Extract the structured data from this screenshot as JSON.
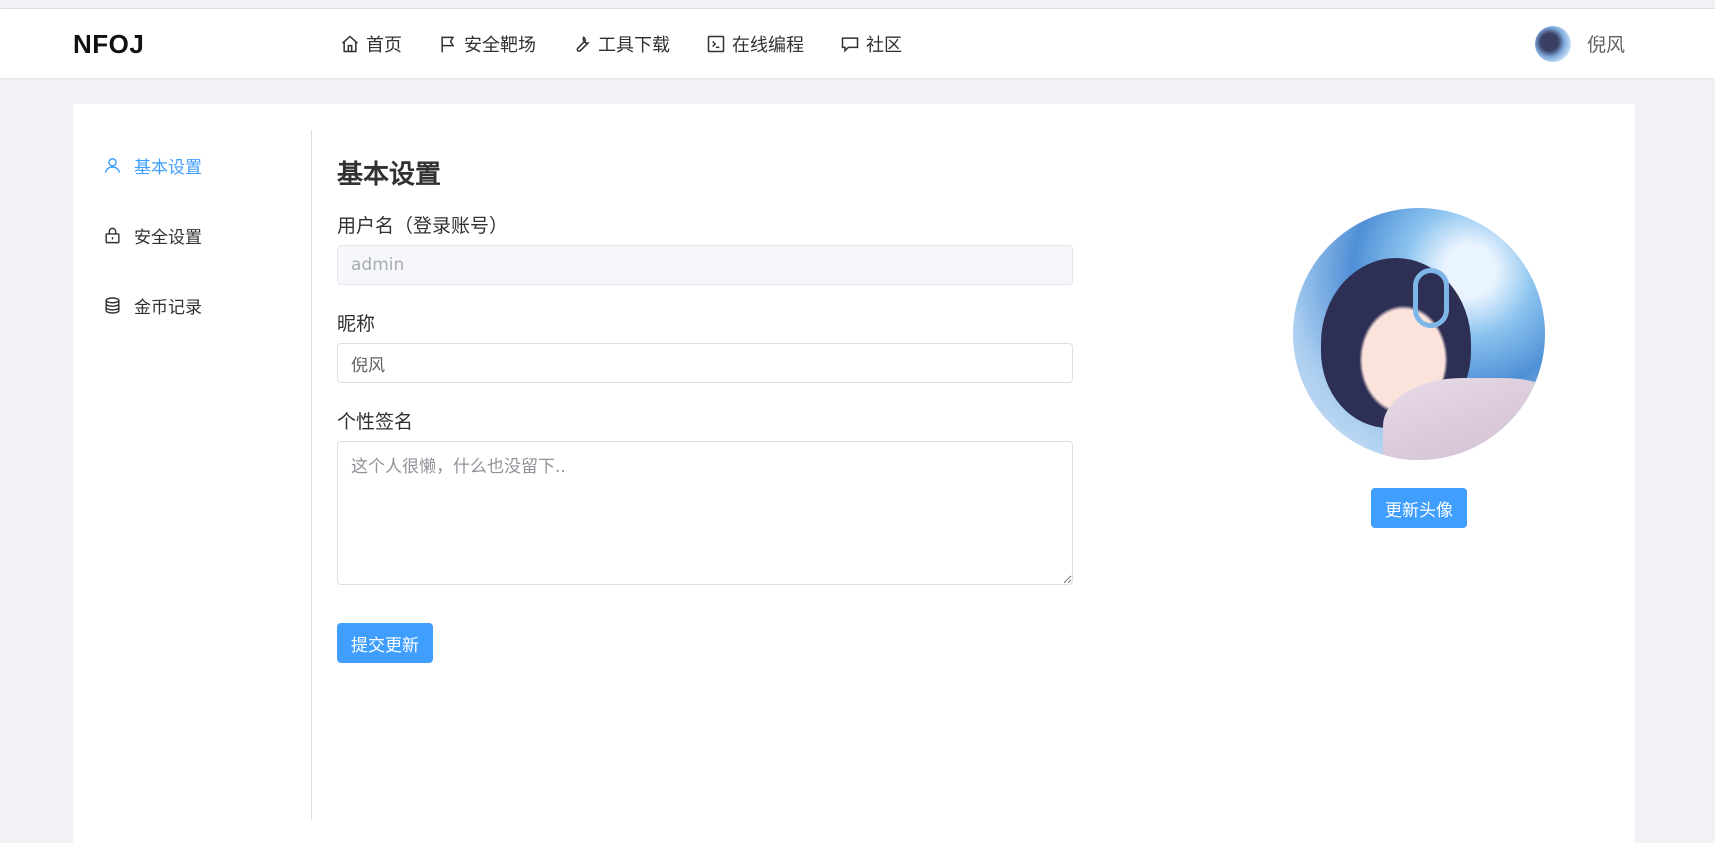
{
  "brand": "NFOJ",
  "nav": [
    {
      "label": "首页",
      "icon": "home-icon"
    },
    {
      "label": "安全靶场",
      "icon": "flag-icon"
    },
    {
      "label": "工具下载",
      "icon": "wrench-icon"
    },
    {
      "label": "在线编程",
      "icon": "terminal-icon"
    },
    {
      "label": "社区",
      "icon": "chat-icon"
    }
  ],
  "user": {
    "name": "倪风"
  },
  "sidebar": {
    "items": [
      {
        "label": "基本设置",
        "icon": "user-icon",
        "active": true
      },
      {
        "label": "安全设置",
        "icon": "lock-icon",
        "active": false
      },
      {
        "label": "金币记录",
        "icon": "coins-icon",
        "active": false
      }
    ]
  },
  "form": {
    "title": "基本设置",
    "username_label": "用户名（登录账号）",
    "username_value": "admin",
    "nickname_label": "昵称",
    "nickname_value": "倪风",
    "signature_label": "个性签名",
    "signature_placeholder": "这个人很懒，什么也没留下..",
    "submit_label": "提交更新"
  },
  "avatar_panel": {
    "update_label": "更新头像"
  },
  "colors": {
    "accent": "#409eff",
    "page_bg": "#f0f2f5"
  }
}
